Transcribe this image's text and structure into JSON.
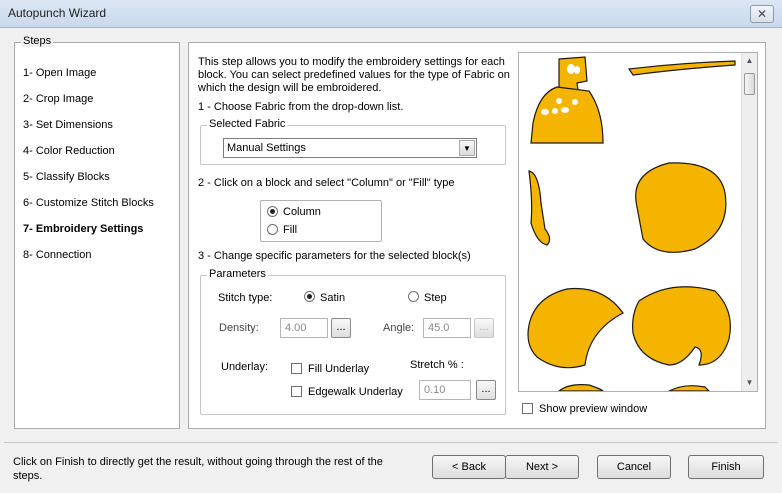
{
  "window": {
    "title": "Autopunch Wizard",
    "close_glyph": "✕"
  },
  "steps": {
    "legend": "Steps",
    "items": [
      {
        "label": "1- Open Image"
      },
      {
        "label": "2- Crop Image"
      },
      {
        "label": "3- Set Dimensions"
      },
      {
        "label": "4- Color Reduction"
      },
      {
        "label": "5- Classify Blocks"
      },
      {
        "label": "6- Customize Stitch Blocks"
      },
      {
        "label": "7- Embroidery Settings",
        "active": true
      },
      {
        "label": "8- Connection"
      }
    ]
  },
  "main": {
    "description": "This step allows you to modify the embroidery settings for each block. You can select predefined values for the type of Fabric on which the design will be embroidered.",
    "step1": "1 - Choose Fabric from the drop-down list.",
    "fabric_group": "Selected Fabric",
    "fabric_value": "Manual Settings",
    "step2": "2 - Click on a block and select \"Column\" or \"Fill\" type",
    "type_column": "Column",
    "type_fill": "Fill",
    "step3": "3 - Change specific parameters for the selected block(s)",
    "params_group": "Parameters",
    "stitch_type_label": "Stitch type:",
    "satin": "Satin",
    "step_label": "Step",
    "density_label": "Density:",
    "density_value": "4.00",
    "angle_label": "Angle:",
    "angle_value": "45.0",
    "underlay_label": "Underlay:",
    "fill_underlay": "Fill Underlay",
    "edgewalk_underlay": "Edgewalk Underlay",
    "stretch_label": "Stretch % :",
    "stretch_value": "0.10",
    "browse": "...",
    "show_preview": "Show preview window"
  },
  "colors": {
    "shape_fill": "#f5b400",
    "shape_stroke": "#1a1a1a"
  },
  "footer": {
    "note": "Click on Finish to directly get the result, without going through the rest of the steps.",
    "back": "< Back",
    "next": "Next >",
    "cancel": "Cancel",
    "finish": "Finish"
  }
}
